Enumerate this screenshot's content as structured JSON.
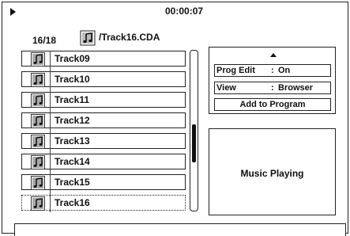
{
  "header": {
    "time": "00:00:07",
    "track_counter": "16/18",
    "file_name": "/Track16.CDA"
  },
  "track_list": {
    "items": [
      {
        "label": "Track09"
      },
      {
        "label": "Track10"
      },
      {
        "label": "Track11"
      },
      {
        "label": "Track12"
      },
      {
        "label": "Track13"
      },
      {
        "label": "Track14"
      },
      {
        "label": "Track15"
      },
      {
        "label": "Track16",
        "selected": true
      }
    ]
  },
  "menu": {
    "prog_edit_key": "Prog Edit",
    "prog_edit_value": "On",
    "view_key": "View",
    "view_value": "Browser",
    "separator": ":",
    "add_to_program": "Add to Program"
  },
  "status": {
    "text": "Music Playing"
  },
  "icons": {
    "play": "play-icon",
    "music_note": "music-note-icon",
    "scroll_up": "arrow-up-icon"
  }
}
